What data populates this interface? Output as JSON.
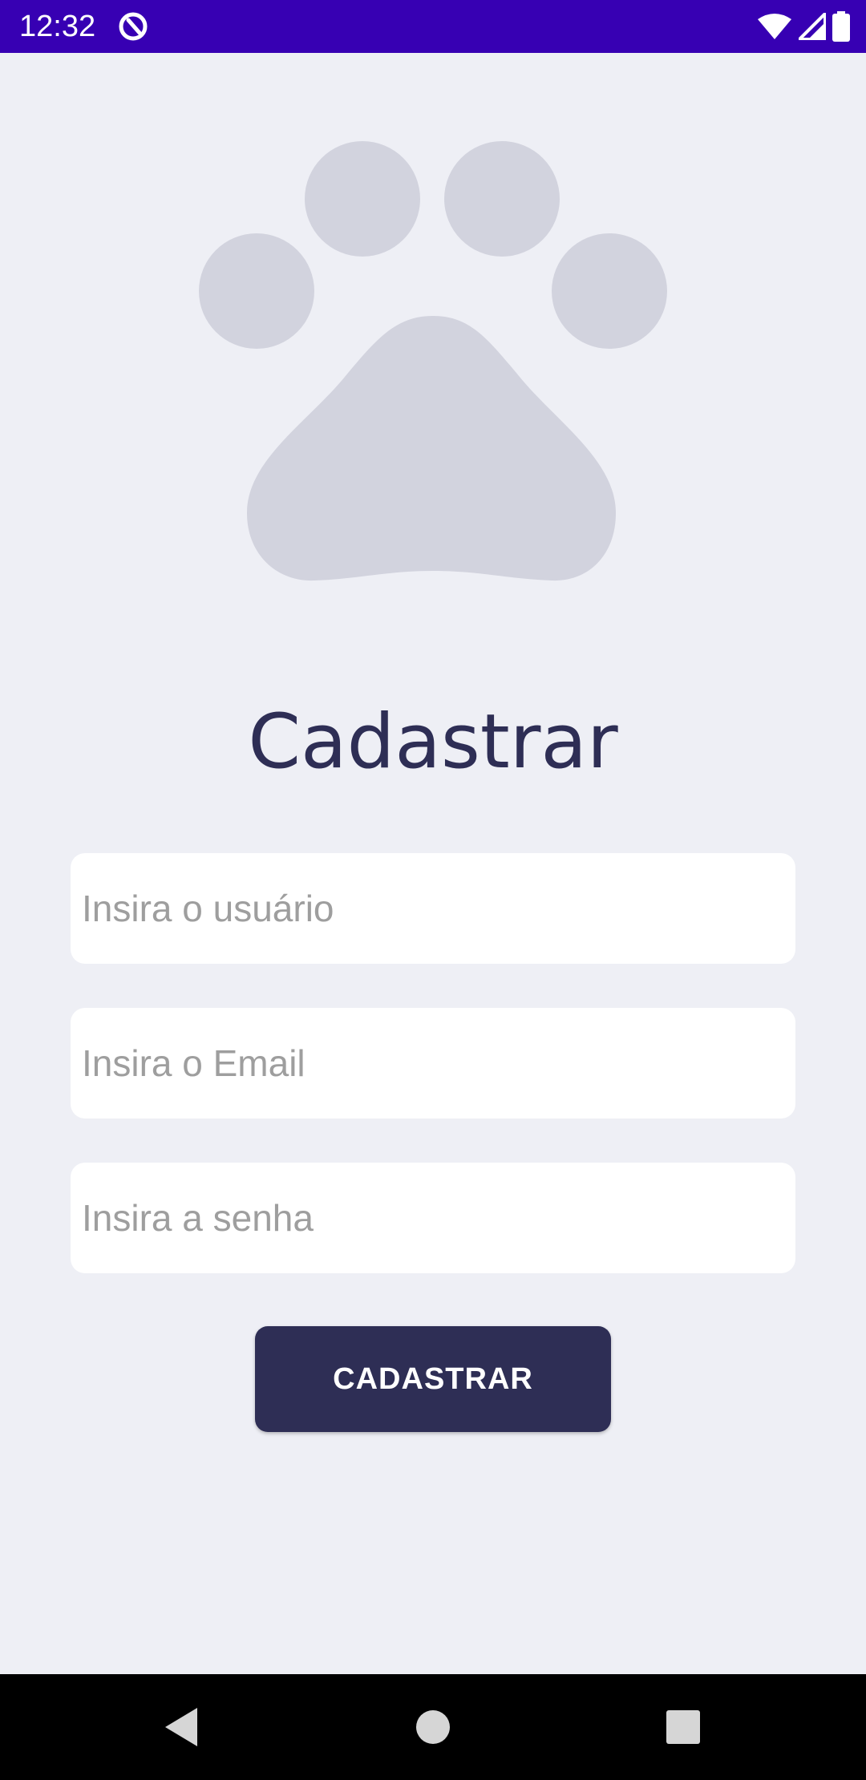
{
  "status_bar": {
    "time": "12:32",
    "background": "#3700B3",
    "icons": [
      "app-notification-icon",
      "wifi-icon",
      "signal-icon",
      "battery-icon"
    ]
  },
  "logo": {
    "icon": "paw-icon",
    "color": "#D2D3DE"
  },
  "form": {
    "title": "Cadastrar",
    "username_placeholder": "Insira o usuário",
    "username_value": "",
    "email_placeholder": "Insira o Email",
    "email_value": "",
    "password_placeholder": "Insira a senha",
    "password_value": "",
    "submit_label": "CADASTRAR"
  },
  "colors": {
    "background": "#EEEFF5",
    "primary": "#2E2E55",
    "field_background": "#FFFFFF",
    "placeholder": "#9E9E9E"
  },
  "nav_bar": {
    "icons": [
      "back-icon",
      "home-icon",
      "recents-icon"
    ]
  }
}
